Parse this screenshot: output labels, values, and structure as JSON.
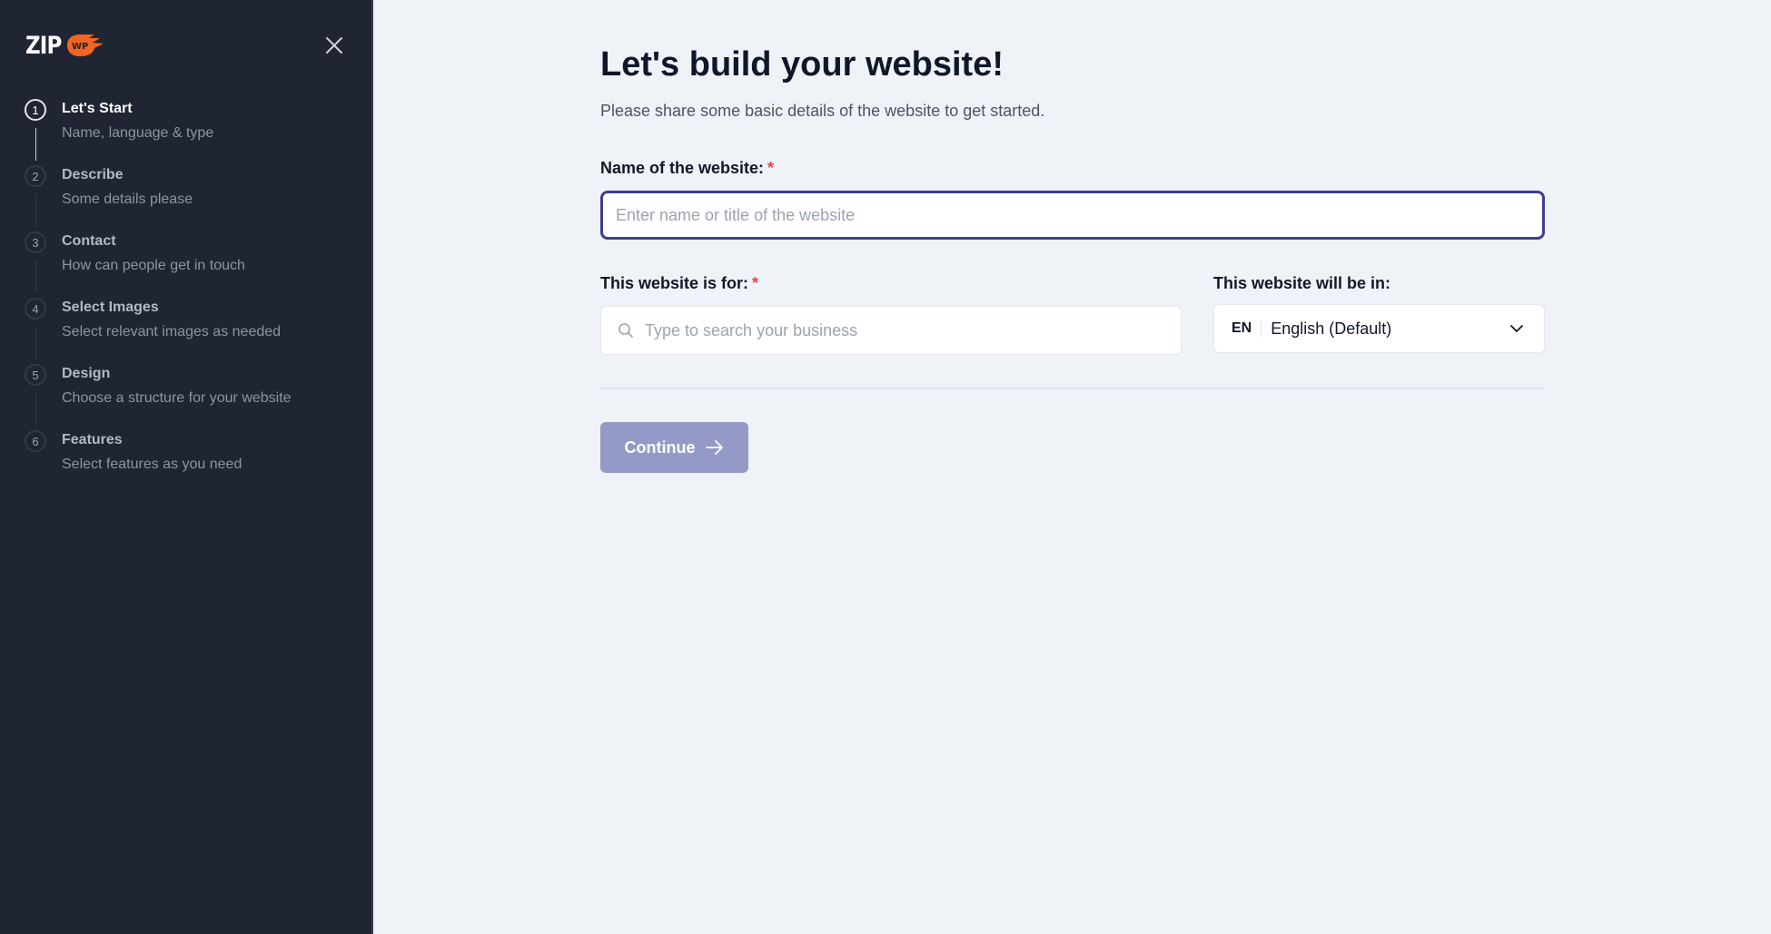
{
  "brand": {
    "name_part1": "ZIP",
    "name_part2": "WP",
    "accent_color": "#f26522"
  },
  "sidebar": {
    "close_icon": "close-icon",
    "steps": [
      {
        "number": "1",
        "title": "Let's Start",
        "subtitle": "Name, language & type",
        "active": true
      },
      {
        "number": "2",
        "title": "Describe",
        "subtitle": "Some details please",
        "active": false
      },
      {
        "number": "3",
        "title": "Contact",
        "subtitle": "How can people get in touch",
        "active": false
      },
      {
        "number": "4",
        "title": "Select Images",
        "subtitle": "Select relevant images as needed",
        "active": false
      },
      {
        "number": "5",
        "title": "Design",
        "subtitle": "Choose a structure for your website",
        "active": false
      },
      {
        "number": "6",
        "title": "Features",
        "subtitle": "Select features as you need",
        "active": false
      }
    ]
  },
  "main": {
    "title": "Let's build your website!",
    "subtitle": "Please share some basic details of the website to get started.",
    "name_field": {
      "label": "Name of the website:",
      "required_mark": "*",
      "value": "",
      "placeholder": "Enter name or title of the website"
    },
    "business_field": {
      "label": "This website is for:",
      "required_mark": "*",
      "value": "",
      "placeholder": "Type to search your business",
      "icon": "search-icon"
    },
    "language_field": {
      "label": "This website will be in:",
      "code": "EN",
      "selected": "English (Default)",
      "icon": "chevron-down-icon"
    },
    "continue_button": {
      "label": "Continue",
      "icon": "arrow-right-icon",
      "color": "#9499c7"
    }
  }
}
